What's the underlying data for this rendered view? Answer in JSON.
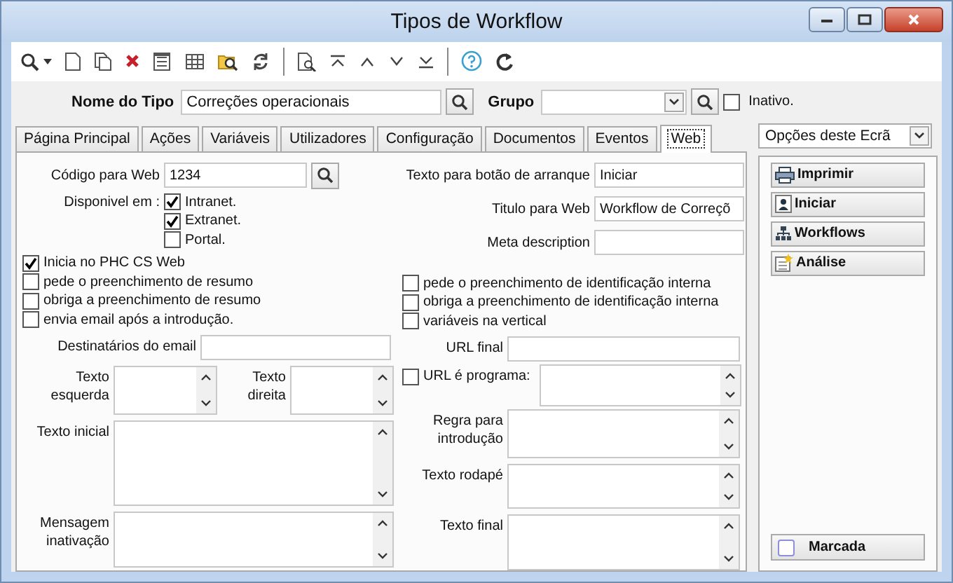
{
  "window": {
    "title": "Tipos de Workflow"
  },
  "header": {
    "name_label": "Nome do Tipo",
    "name_value": "Correções operacionais",
    "group_label": "Grupo",
    "inactive": {
      "label": "Inativo.",
      "checked": false
    }
  },
  "tabs": [
    {
      "label": "Página Principal",
      "selected": false
    },
    {
      "label": "Ações",
      "selected": false
    },
    {
      "label": "Variáveis",
      "selected": false
    },
    {
      "label": "Utilizadores",
      "selected": false
    },
    {
      "label": "Configuração",
      "selected": false
    },
    {
      "label": "Documentos",
      "selected": false
    },
    {
      "label": "Eventos",
      "selected": false
    },
    {
      "label": "Web",
      "selected": true
    }
  ],
  "web": {
    "code": {
      "label": "Código para Web",
      "value": "1234"
    },
    "available": {
      "label": "Disponivel em :",
      "options": [
        {
          "label": "Intranet.",
          "checked": true
        },
        {
          "label": "Extranet.",
          "checked": true
        },
        {
          "label": "Portal.",
          "checked": false
        }
      ]
    },
    "left_checks": [
      {
        "label": "Inicia no PHC CS Web",
        "checked": true
      },
      {
        "label": "pede o preenchimento de resumo",
        "checked": false
      },
      {
        "label": "obriga a preenchimento de resumo",
        "checked": false
      },
      {
        "label": "envia email após a introdução.",
        "checked": false
      }
    ],
    "email": {
      "label": "Destinatários do email"
    },
    "text_left": {
      "label": "Texto esquerda"
    },
    "text_right": {
      "label": "Texto direita"
    },
    "initial_text": {
      "label": "Texto inicial"
    },
    "inactivation_message": {
      "label": "Mensagem inativação"
    },
    "start_button_text": {
      "label": "Texto para botão de arranque",
      "value": "Iniciar"
    },
    "web_title": {
      "label": "Titulo para Web",
      "value": "Workflow de Correçõ"
    },
    "meta_description": {
      "label": "Meta description"
    },
    "right_checks": [
      {
        "label": "pede o preenchimento de identificação interna",
        "checked": false
      },
      {
        "label": "obriga a preenchimento de identificação interna",
        "checked": false
      },
      {
        "label": "variáveis na vertical",
        "checked": false
      }
    ],
    "url_final": {
      "label": "URL final"
    },
    "url_is_program": {
      "label": "URL é programa:",
      "checked": false
    },
    "entry_rule": {
      "label": "Regra para introdução"
    },
    "footer_text": {
      "label": "Texto rodapé"
    },
    "final_text": {
      "label": "Texto final"
    }
  },
  "side_panel": {
    "dropdown": "Opções deste Ecrã",
    "buttons": [
      {
        "label": "Imprimir",
        "kind": "print"
      },
      {
        "label": "Iniciar",
        "kind": "start"
      },
      {
        "label": "Workflows",
        "kind": "tree"
      },
      {
        "label": "Análise",
        "kind": "analysis"
      }
    ],
    "marked": {
      "label": "Marcada",
      "checked": false
    }
  }
}
